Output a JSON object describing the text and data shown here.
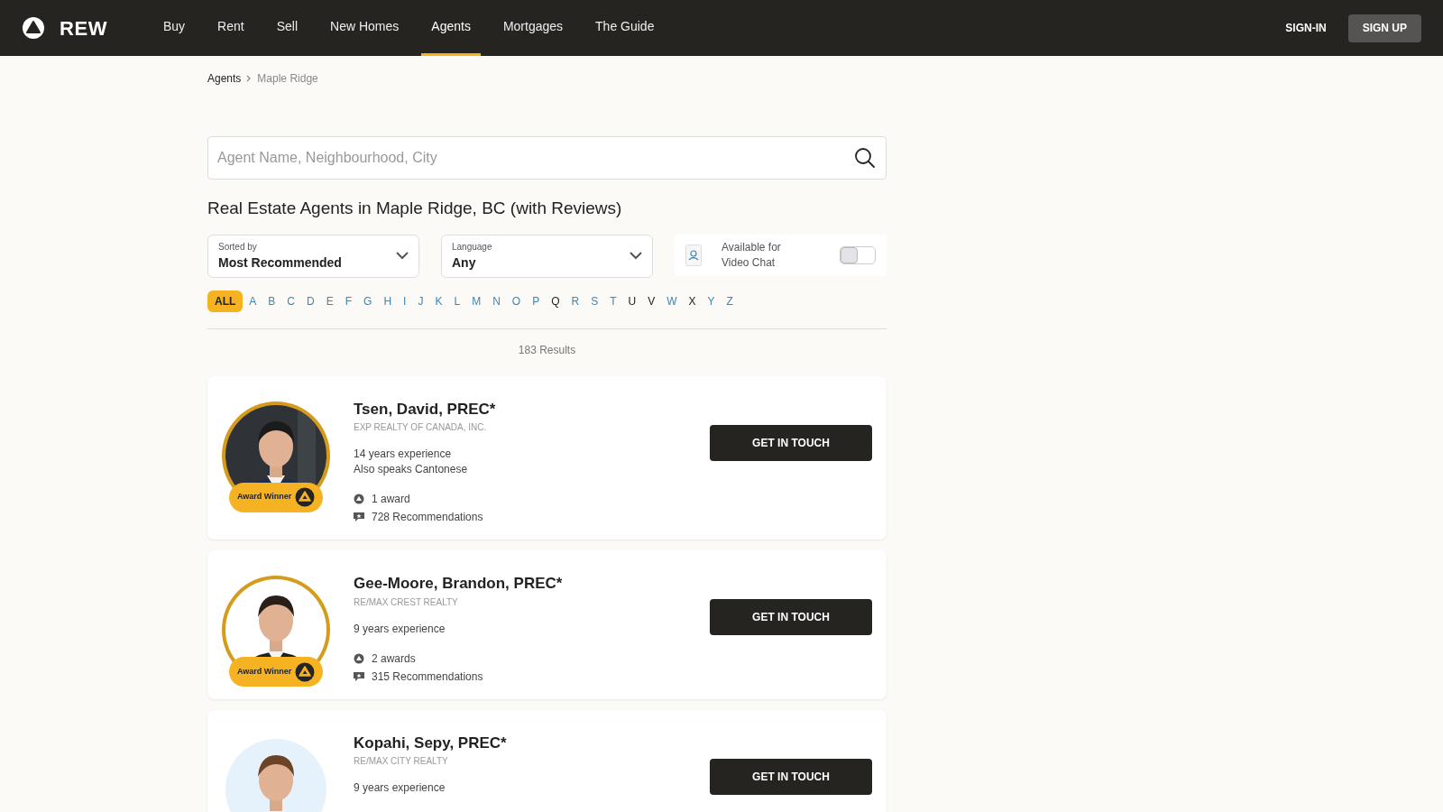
{
  "nav": {
    "logo": "REW",
    "links": [
      {
        "label": "Buy",
        "selected": false
      },
      {
        "label": "Rent",
        "selected": false
      },
      {
        "label": "Sell",
        "selected": false
      },
      {
        "label": "New Homes",
        "selected": false
      },
      {
        "label": "Agents",
        "selected": true
      },
      {
        "label": "Mortgages",
        "selected": false
      },
      {
        "label": "The Guide",
        "selected": false
      }
    ],
    "sign_in": "SIGN-IN",
    "sign_up": "SIGN UP"
  },
  "breadcrumb": [
    "Agents",
    "Maple Ridge"
  ],
  "search": {
    "placeholder": "Agent Name, Neighbourhood, City"
  },
  "heading": "Real Estate Agents in Maple Ridge, BC (with Reviews)",
  "filters": [
    {
      "label": "Sorted by",
      "value": "Most Recommended"
    },
    {
      "label": "Language",
      "value": "Any"
    }
  ],
  "video_chat": {
    "label": "Available for Video Chat",
    "on": false
  },
  "letters": [
    {
      "label": "ALL",
      "selected": true,
      "disabled": false
    },
    {
      "label": "A",
      "selected": false,
      "disabled": false
    },
    {
      "label": "B",
      "selected": false,
      "disabled": false
    },
    {
      "label": "C",
      "selected": false,
      "disabled": false
    },
    {
      "label": "D",
      "selected": false,
      "disabled": false
    },
    {
      "label": "E",
      "selected": false,
      "disabled": false
    },
    {
      "label": "F",
      "selected": false,
      "disabled": false
    },
    {
      "label": "G",
      "selected": false,
      "disabled": false
    },
    {
      "label": "H",
      "selected": false,
      "disabled": false
    },
    {
      "label": "I",
      "selected": false,
      "disabled": false
    },
    {
      "label": "J",
      "selected": false,
      "disabled": false
    },
    {
      "label": "K",
      "selected": false,
      "disabled": false
    },
    {
      "label": "L",
      "selected": false,
      "disabled": false
    },
    {
      "label": "M",
      "selected": false,
      "disabled": false
    },
    {
      "label": "N",
      "selected": false,
      "disabled": false
    },
    {
      "label": "O",
      "selected": false,
      "disabled": false
    },
    {
      "label": "P",
      "selected": false,
      "disabled": false
    },
    {
      "label": "Q",
      "selected": false,
      "disabled": true
    },
    {
      "label": "R",
      "selected": false,
      "disabled": false
    },
    {
      "label": "S",
      "selected": false,
      "disabled": false
    },
    {
      "label": "T",
      "selected": false,
      "disabled": false
    },
    {
      "label": "U",
      "selected": false,
      "disabled": true
    },
    {
      "label": "V",
      "selected": false,
      "disabled": true
    },
    {
      "label": "W",
      "selected": false,
      "disabled": false
    },
    {
      "label": "X",
      "selected": false,
      "disabled": true
    },
    {
      "label": "Y",
      "selected": false,
      "disabled": false
    },
    {
      "label": "Z",
      "selected": false,
      "disabled": false
    }
  ],
  "results": "183 Results",
  "agents": [
    {
      "name": "Tsen, David, PREC*",
      "brokerage": "EXP REALTY OF CANADA, INC.",
      "details": [
        "14 years experience",
        "Also speaks Cantonese"
      ],
      "awards": "1 award",
      "recommendations": "728 Recommendations",
      "award_badge": "Award Winner",
      "button": "GET IN TOUCH",
      "photo": {
        "kind": "picture"
      }
    },
    {
      "name": "Gee-Moore, Brandon, PREC*",
      "brokerage": "RE/MAX CREST REALTY",
      "details": [
        "9 years experience"
      ],
      "awards": "2 awards",
      "recommendations": "315 Recommendations",
      "award_badge": "Award Winner",
      "button": "GET IN TOUCH",
      "photo": {
        "kind": "picture"
      }
    },
    {
      "name": "Kopahi, Sepy, PREC*",
      "brokerage": "RE/MAX CITY REALTY",
      "details": [
        "9 years experience"
      ],
      "button": "GET IN TOUCH",
      "photo": {
        "kind": "picture"
      }
    }
  ]
}
